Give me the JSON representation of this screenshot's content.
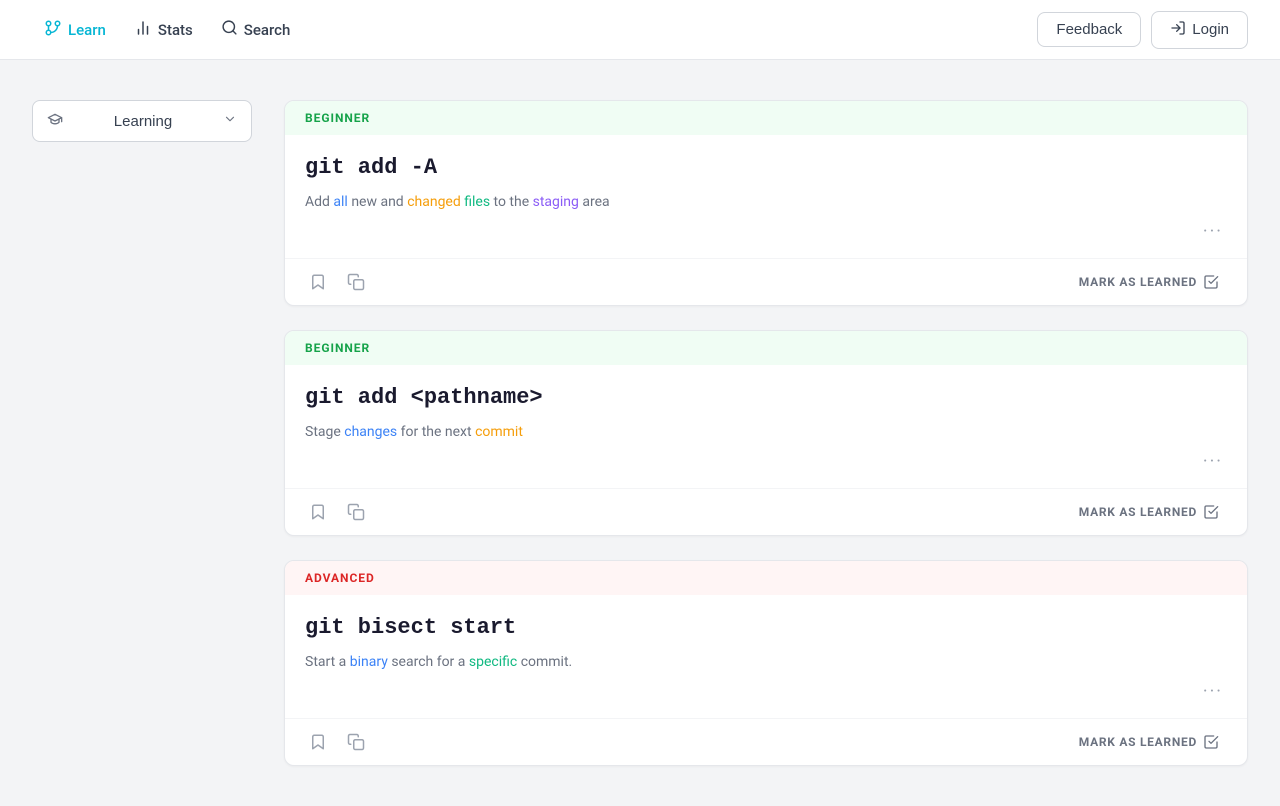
{
  "navbar": {
    "items": [
      {
        "id": "learn",
        "label": "Learn",
        "icon": "branch-icon",
        "active": true
      },
      {
        "id": "stats",
        "label": "Stats",
        "icon": "stats-icon",
        "active": false
      },
      {
        "id": "search",
        "label": "Search",
        "icon": "search-icon",
        "active": false
      }
    ],
    "feedback_label": "Feedback",
    "login_label": "Login",
    "login_icon": "login-icon"
  },
  "sidebar": {
    "dropdown_label": "Learning",
    "dropdown_icon": "graduation-icon",
    "chevron_icon": "chevron-down-icon"
  },
  "cards": [
    {
      "id": "card-1",
      "level": "BEGINNER",
      "level_type": "beginner",
      "command": "git add -A",
      "description_parts": [
        {
          "text": "Add ",
          "highlight": false
        },
        {
          "text": "all",
          "highlight": "all"
        },
        {
          "text": " new and ",
          "highlight": false
        },
        {
          "text": "changed",
          "highlight": "changed"
        },
        {
          "text": " ",
          "highlight": false
        },
        {
          "text": "files",
          "highlight": "files"
        },
        {
          "text": " to the ",
          "highlight": false
        },
        {
          "text": "staging",
          "highlight": "staging"
        },
        {
          "text": " area",
          "highlight": false
        }
      ],
      "mark_learned_label": "MARK AS LEARNED"
    },
    {
      "id": "card-2",
      "level": "BEGINNER",
      "level_type": "beginner",
      "command": "git add <pathname>",
      "description_parts": [
        {
          "text": "Stage ",
          "highlight": false
        },
        {
          "text": "changes",
          "highlight": "changes"
        },
        {
          "text": " for the next ",
          "highlight": false
        },
        {
          "text": "commit",
          "highlight": "commit"
        }
      ],
      "mark_learned_label": "MARK AS LEARNED"
    },
    {
      "id": "card-3",
      "level": "ADVANCED",
      "level_type": "advanced",
      "command": "git bisect start",
      "description_parts": [
        {
          "text": "Start a ",
          "highlight": false
        },
        {
          "text": "binary",
          "highlight": "binary"
        },
        {
          "text": " search for a ",
          "highlight": false
        },
        {
          "text": "specific",
          "highlight": "specific"
        },
        {
          "text": " commit.",
          "highlight": false
        }
      ],
      "mark_learned_label": "MARK AS LEARNED"
    }
  ],
  "colors": {
    "beginner_bg": "#f0fdf4",
    "beginner_text": "#16a34a",
    "advanced_bg": "#fff5f5",
    "advanced_text": "#dc2626"
  }
}
